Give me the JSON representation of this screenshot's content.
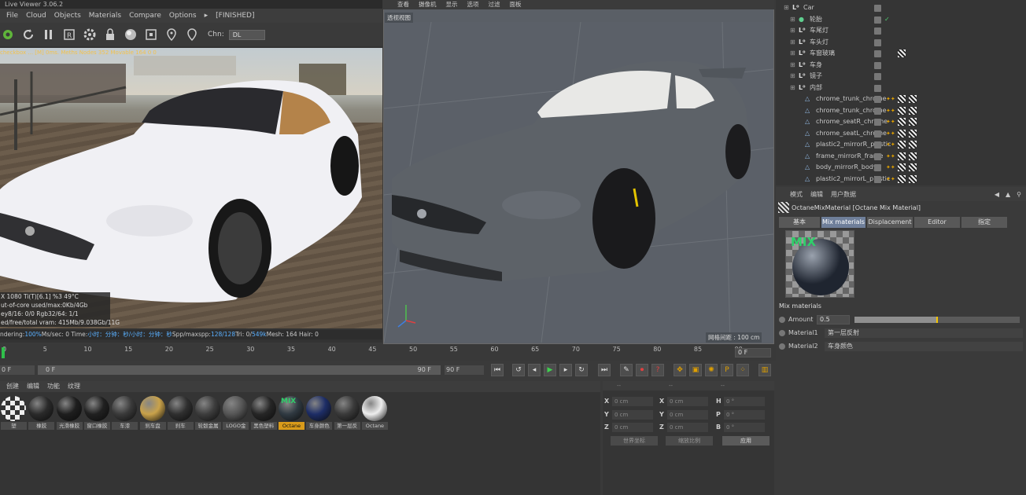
{
  "live_viewer": {
    "title": "Live Viewer 3.06.2",
    "menu": [
      "File",
      "Cloud",
      "Objects",
      "Materials",
      "Compare",
      "Options"
    ],
    "status": "[FINISHED]",
    "channel_label": "Chn:",
    "channel_value": "DL",
    "info_top": "checkbox ... [M] 0ms. Meths Nodes 352 Movable 164  0 0",
    "stats": [
      "X 1080 Ti(T)[6.1]    %3      49°C",
      "ut-of-core used/max:0Kb/4Gb",
      "ey8/16: 0/0          Rgb32/64: 1/1",
      "ed/free/total vram: 415Mb/9.038Gb/11G"
    ],
    "status_bar": {
      "rendering": "ndering: ",
      "rendering_val": "100%",
      "ms_sec": "   Ms/sec: 0   Time: ",
      "time_val": "小时：分钟：秒/小时：分钟：秒",
      "spp": "   Spp/maxspp: ",
      "spp_val": "128/128",
      "tri": "   Tri: 0/",
      "tri_val": "549k",
      "mesh": "   Mesh: 164  Hair: 0"
    }
  },
  "viewport": {
    "menu": [
      "查看",
      "摄像机",
      "显示",
      "选项",
      "过滤",
      "面板"
    ],
    "label": "透视视图",
    "grid_info": "网格间距 : 100 cm"
  },
  "object_manager": {
    "rows": [
      {
        "name": "Car",
        "indent": 0,
        "kind": "null"
      },
      {
        "name": "轮胎",
        "indent": 1,
        "kind": "green"
      },
      {
        "name": "车尾灯",
        "indent": 1,
        "kind": "null"
      },
      {
        "name": "车头灯",
        "indent": 1,
        "kind": "null"
      },
      {
        "name": "车窗玻璃",
        "indent": 1,
        "kind": "null"
      },
      {
        "name": "车身",
        "indent": 1,
        "kind": "null"
      },
      {
        "name": "镜子",
        "indent": 1,
        "kind": "null"
      },
      {
        "name": "内部",
        "indent": 1,
        "kind": "null"
      },
      {
        "name": "chrome_trunk_chrome",
        "indent": 2,
        "kind": "mesh"
      },
      {
        "name": "chrome_trunk_chrome",
        "indent": 2,
        "kind": "mesh"
      },
      {
        "name": "chrome_seatR_chrome",
        "indent": 2,
        "kind": "mesh"
      },
      {
        "name": "chrome_seatL_chrome",
        "indent": 2,
        "kind": "mesh"
      },
      {
        "name": "plastic2_mirrorR_plastic",
        "indent": 2,
        "kind": "mesh"
      },
      {
        "name": "frame_mirrorR_frame",
        "indent": 2,
        "kind": "mesh"
      },
      {
        "name": "body_mirrorR_body",
        "indent": 2,
        "kind": "mesh"
      },
      {
        "name": "plastic2_mirrorL_plastic",
        "indent": 2,
        "kind": "mesh"
      }
    ]
  },
  "attributes": {
    "head_tabs": [
      "模式",
      "编辑",
      "用户数据"
    ],
    "title": "OctaneMixMaterial [Octane Mix Material]",
    "tabs": [
      "基本",
      "Mix materials",
      "Displacement",
      "Editor",
      "指定"
    ],
    "active_tab": "Mix materials",
    "preview_text": "MIX",
    "section": "Mix materials",
    "amount_label": "Amount",
    "amount_value": "0.5",
    "amount_fraction": 0.5,
    "material1_label": "Material1",
    "material1_value": "第一层反射",
    "material2_label": "Material2",
    "material2_value": "车身颜色"
  },
  "timeline": {
    "ticks": [
      "0",
      "5",
      "10",
      "15",
      "20",
      "25",
      "30",
      "35",
      "40",
      "45",
      "50",
      "55",
      "60",
      "65",
      "70",
      "75",
      "80",
      "85",
      "90"
    ],
    "current_frame": "0 F",
    "start": "0 F",
    "range_start": "0 F",
    "range_end": "90 F",
    "end": "90 F"
  },
  "material_manager": {
    "menu": [
      "创建",
      "编辑",
      "功能",
      "纹理"
    ],
    "materials": [
      {
        "name": "塑",
        "color": "#d8d8d8",
        "check": true
      },
      {
        "name": "橡胶",
        "color": "#2a2a2a"
      },
      {
        "name": "光滑橡胶",
        "color": "#1e1e1e"
      },
      {
        "name": "窗口橡胶",
        "color": "#202020"
      },
      {
        "name": "车漆",
        "color": "#3a3a3a"
      },
      {
        "name": "刹车盘",
        "color": "#c9a24a"
      },
      {
        "name": "刹车",
        "color": "#2f2f2f"
      },
      {
        "name": "轮毂金属",
        "color": "#3d3d3d"
      },
      {
        "name": "LOGO金",
        "color": "#555"
      },
      {
        "name": "黑色塑料",
        "color": "#262626"
      },
      {
        "name": "Octane",
        "color": "#303a42",
        "mix": true,
        "selected": true
      },
      {
        "name": "车身颜色",
        "color": "#1d2d66"
      },
      {
        "name": "第一层反",
        "color": "#3a3a3a"
      },
      {
        "name": "Octane",
        "color": "#eeeeee"
      }
    ]
  },
  "coords": {
    "head": [
      "--",
      "--",
      "--"
    ],
    "rows": [
      {
        "a": "X",
        "av": "0 cm",
        "b": "X",
        "bv": "0 cm",
        "c": "H",
        "cv": "0 °"
      },
      {
        "a": "Y",
        "av": "0 cm",
        "b": "Y",
        "bv": "0 cm",
        "c": "P",
        "cv": "0 °"
      },
      {
        "a": "Z",
        "av": "0 cm",
        "b": "Z",
        "bv": "0 cm",
        "c": "B",
        "cv": "0 °"
      }
    ],
    "mode1": "世界坐标",
    "mode2": "缩放比例",
    "apply": "应用"
  }
}
